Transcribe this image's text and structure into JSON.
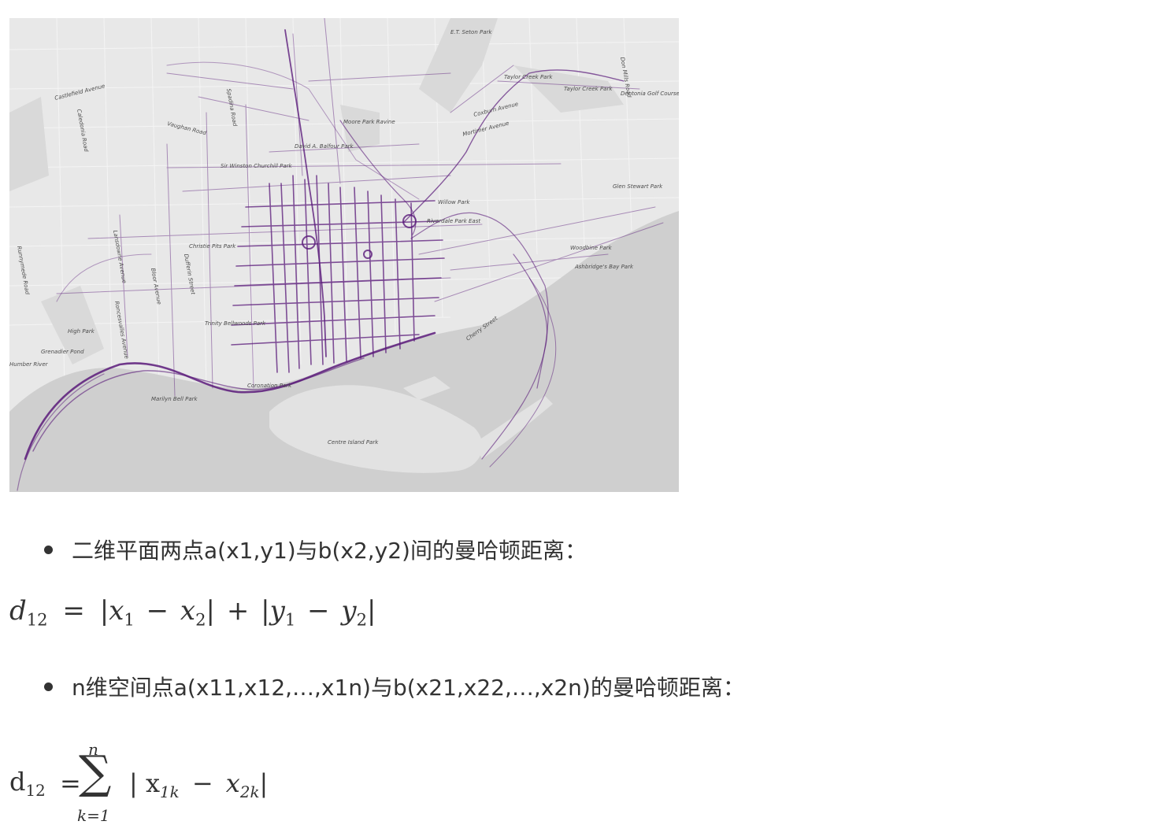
{
  "figure": {
    "alt": "Toronto run heat map",
    "labels": [
      "E.T. Seton Park",
      "Taylor Creek Park",
      "Taylor Creek Park",
      "Dentonia Golf Course",
      "Coxburn Avenue",
      "Moore Park Ravine",
      "Mortimer Avenue",
      "David A. Balfour Park",
      "Sir Winston Churchill Park",
      "Willow Park",
      "Glen Stewart Park",
      "Riverdale Park East",
      "Christie Pits Park",
      "Woodbine Park",
      "Ashbridge's Bay Park",
      "Trinity Bellwoods Park",
      "High Park",
      "Grenadier Pond",
      "Coronation Park",
      "Marilyn Bell Park",
      "Centre Island Park",
      "Castlefield Avenue",
      "Vaughan Road",
      "Spadina Road",
      "Caledonia Road",
      "Lansdowne Avenue",
      "Runnymede Road",
      "Dufferin Street",
      "Roncesvalles Avenue",
      "Bloor Avenue",
      "Humber River",
      "Don Mills Road",
      "Cherry Street"
    ]
  },
  "bullets": [
    "二维平面两点a(x1,y1)与b(x2,y2)间的曼哈顿距离：",
    "n维空间点a(x11,x12,…,x1n)与b(x21,x22,…,x2n)的曼哈顿距离："
  ],
  "formula1": {
    "lhs": "d",
    "lhs_sub": "12",
    "eq": "=",
    "t1a": "x",
    "t1a_sub": "1",
    "minus1": "−",
    "t1b": "x",
    "t1b_sub": "2",
    "plus": "+",
    "t2a": "y",
    "t2a_sub": "1",
    "minus2": "−",
    "t2b": "y",
    "t2b_sub": "2"
  },
  "formula2": {
    "lhs": "d",
    "lhs_sub": "12",
    "eq": "=",
    "sigma": "∑",
    "upper": "n",
    "lower": "k=1",
    "t1": "x",
    "t1_sub": "1k",
    "minus": "−",
    "t2": "x",
    "t2_sub": "2k"
  },
  "colors": {
    "route": "#5a1a7a",
    "land": "#e6e6e6",
    "water": "#c8c8c8",
    "text": "#333333"
  }
}
